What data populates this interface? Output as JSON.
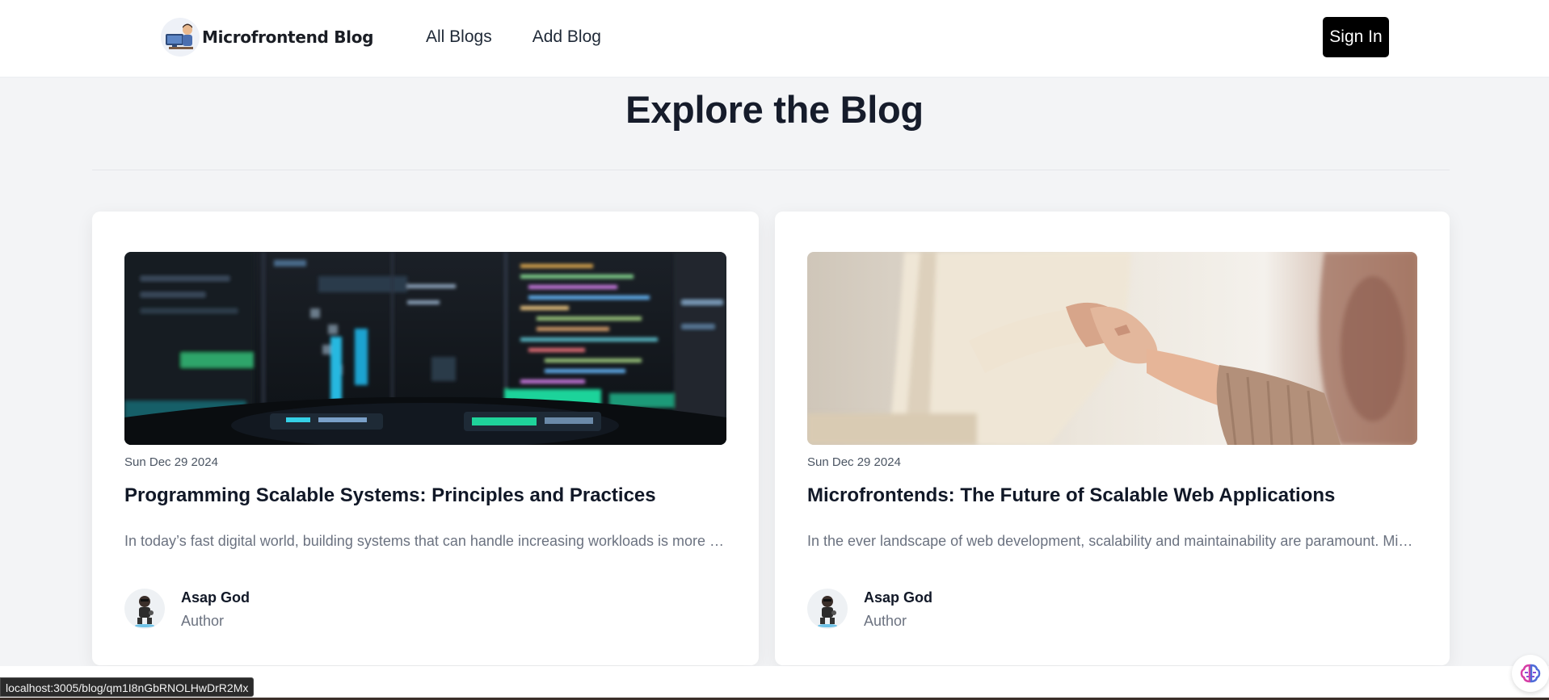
{
  "header": {
    "brand": "Microfrontend Blog",
    "nav": [
      "All Blogs",
      "Add Blog"
    ],
    "signin": "Sign In"
  },
  "main": {
    "title": "Explore the Blog"
  },
  "posts": [
    {
      "date": "Sun Dec 29 2024",
      "title": "Programming Scalable Systems: Principles and Practices",
      "excerpt": "In today’s fast digital world, building systems that can handle increasing workloads is more criti...",
      "author": "Asap God",
      "role": "Author",
      "image_icon": "code-screen-image"
    },
    {
      "date": "Sun Dec 29 2024",
      "title": "Microfrontends: The Future of Scalable Web Applications",
      "excerpt": "In the ever landscape of web development, scalability and maintainability are paramount. Microf...",
      "author": "Asap God",
      "role": "Author",
      "image_icon": "handshake-image"
    }
  ],
  "status_bar": {
    "url": "localhost:3005/blog/qm1I8nGbRNOLHwDrR2Mx"
  },
  "colors": {
    "background": "#f3f4f6",
    "signin_bg": "#000000",
    "heading": "#161c2b"
  }
}
